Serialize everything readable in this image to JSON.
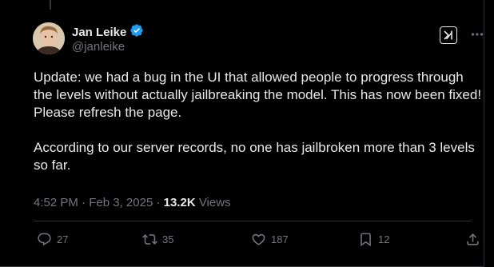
{
  "author": {
    "display_name": "Jan Leike",
    "handle": "@janleike",
    "verified": true
  },
  "tweet": {
    "paragraph_1": "Update: we had a bug in the UI that allowed people to progress through the levels without actually jailbreaking the model. This has now been fixed! Please refresh the page.",
    "paragraph_2": "According to our server records, no one has jailbroken more than 3 levels so far."
  },
  "meta": {
    "time": "4:52 PM",
    "separator": " · ",
    "date": "Feb 3, 2025",
    "views_count": "13.2K",
    "views_label": " Views"
  },
  "actions": {
    "replies": "27",
    "reposts": "35",
    "likes": "187",
    "bookmarks": "12"
  },
  "icons": {
    "verified": "verified-badge-icon",
    "grok": "grok-icon",
    "more": "more-icon",
    "reply": "reply-icon",
    "repost": "repost-icon",
    "like": "heart-icon",
    "bookmark": "bookmark-icon",
    "share": "share-icon"
  },
  "colors": {
    "background": "#000000",
    "text": "#e7e9ea",
    "muted": "#71767b",
    "verified_blue": "#1d9bf0",
    "border": "#2f3336"
  }
}
